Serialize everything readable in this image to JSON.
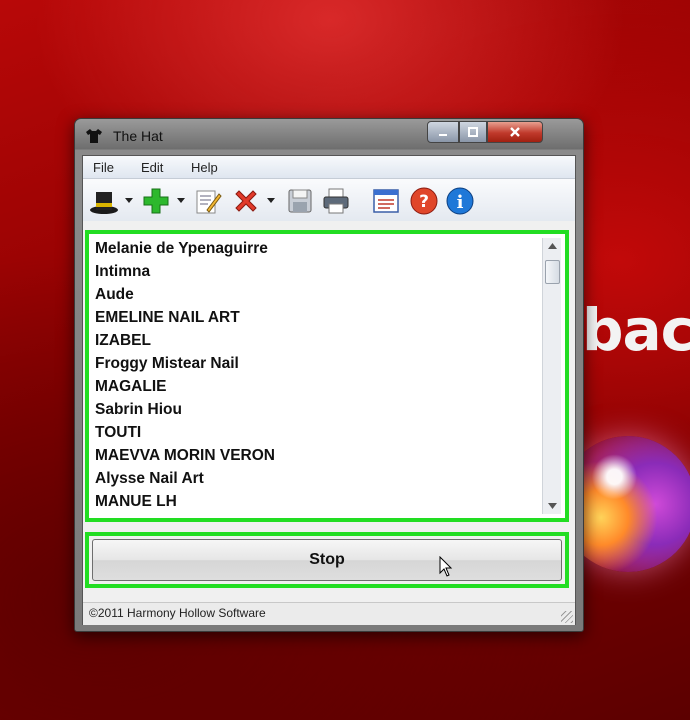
{
  "window": {
    "title": "The Hat",
    "controls": {
      "minimize_icon": "minimize-icon",
      "maximize_icon": "maximize-icon",
      "close_icon": "close-icon"
    }
  },
  "menubar": {
    "items": [
      "File",
      "Edit",
      "Help"
    ]
  },
  "toolbar": {
    "buttons": [
      "hat-icon",
      "add-icon",
      "edit-icon",
      "delete-icon",
      "save-icon",
      "print-icon",
      "list-settings-icon",
      "help-icon",
      "info-icon"
    ]
  },
  "names_list": {
    "items": [
      "Melanie de Ypenaguirre",
      "Intimna",
      "Aude",
      "EMELINE NAIL ART",
      "IZABEL",
      "Froggy Mistear Nail",
      "MAGALIE",
      "Sabrin Hiou",
      "TOUTI",
      "MAEVVA MORIN VERON",
      "Alysse Nail Art",
      "MANUE LH"
    ]
  },
  "action": {
    "stop_label": "Stop"
  },
  "status": {
    "text": "©2011 Harmony Hollow Software"
  },
  "desktop": {
    "wallpaper_text": "bac"
  },
  "colors": {
    "highlight_border": "#22dd22",
    "wallpaper": "#a00000"
  }
}
